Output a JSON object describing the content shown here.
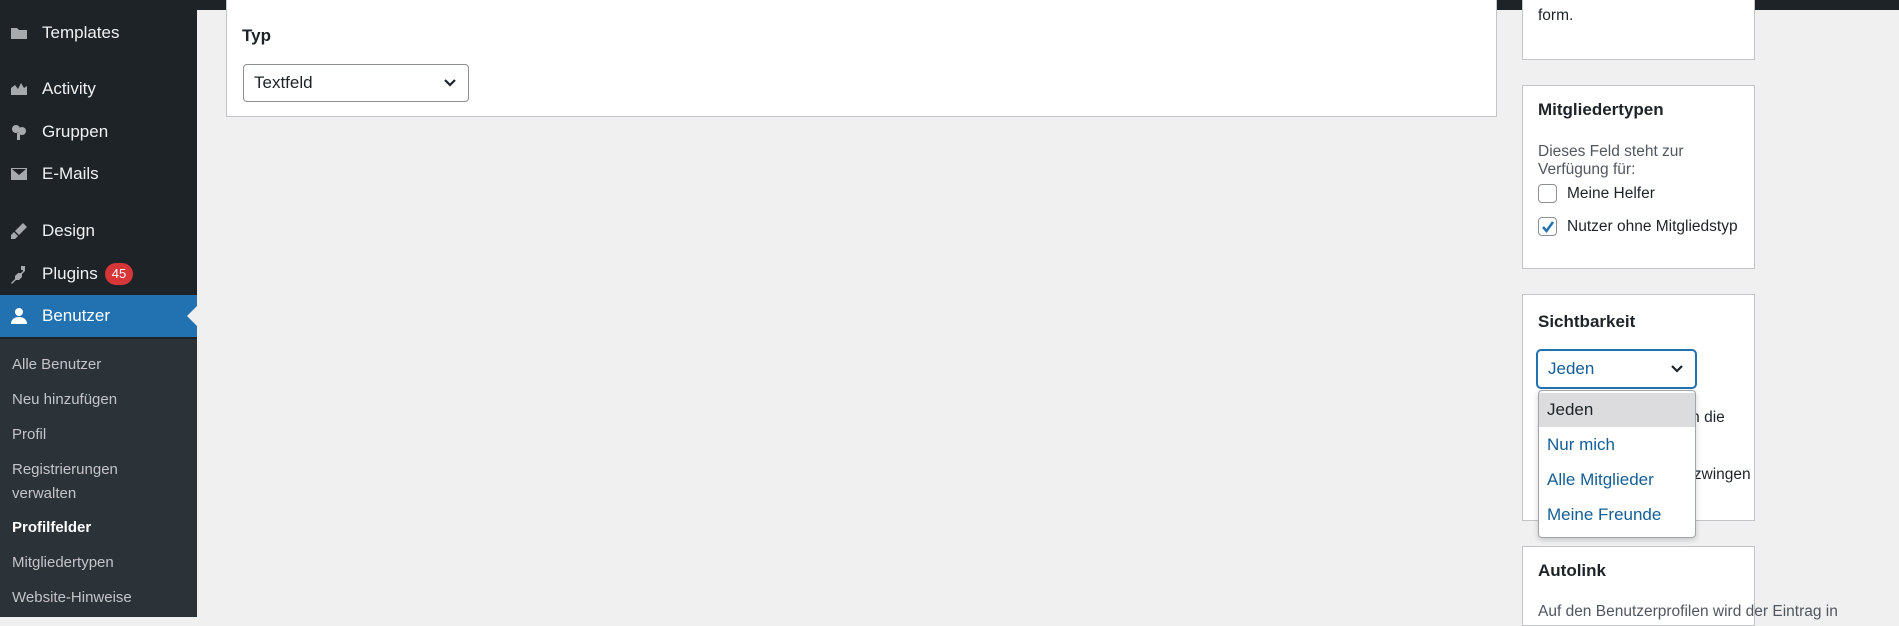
{
  "sidebar": {
    "items": [
      {
        "label": "Templates",
        "icon": "folder-icon"
      },
      {
        "label": "Activity",
        "icon": "activity-icon"
      },
      {
        "label": "Gruppen",
        "icon": "groups-icon"
      },
      {
        "label": "E-Mails",
        "icon": "email-icon"
      },
      {
        "label": "Design",
        "icon": "paintbrush-icon"
      },
      {
        "label": "Plugins",
        "icon": "plugin-icon",
        "badge": "45"
      },
      {
        "label": "Benutzer",
        "icon": "user-icon"
      }
    ],
    "submenu": [
      {
        "label": "Alle Benutzer"
      },
      {
        "label": "Neu hinzufügen"
      },
      {
        "label": "Profil"
      },
      {
        "label": "Registrierungen verwalten"
      },
      {
        "label": "Profilfelder"
      },
      {
        "label": "Mitgliedertypen"
      },
      {
        "label": "Website-Hinweise"
      }
    ]
  },
  "main": {
    "typ_label": "Typ",
    "typ_select_value": "Textfeld"
  },
  "right": {
    "top_panel_text": "form.",
    "mitgliedertypen": {
      "title": "Mitgliedertypen",
      "description": "Dieses Feld steht zur Verfügung für:",
      "options": [
        {
          "label": "Meine Helfer",
          "checked": false
        },
        {
          "label": "Nutzer ohne Mitgliedstyp",
          "checked": true
        }
      ]
    },
    "sichtbarkeit": {
      "title": "Sichtbarkeit",
      "select_value": "Jeden",
      "hidden_text_1": "rn die",
      "hidden_text_2": "erzwingen",
      "dropdown_options": [
        "Jeden",
        "Nur mich",
        "Alle Mitglieder",
        "Meine Freunde"
      ],
      "selected_index": 0
    },
    "autolink": {
      "title": "Autolink",
      "text": "Auf den Benutzerprofilen wird der Eintrag in"
    }
  },
  "colors": {
    "sidebar_bg": "#1d2327",
    "submenu_bg": "#2c3338",
    "accent": "#2271b1",
    "badge": "#d63638"
  }
}
